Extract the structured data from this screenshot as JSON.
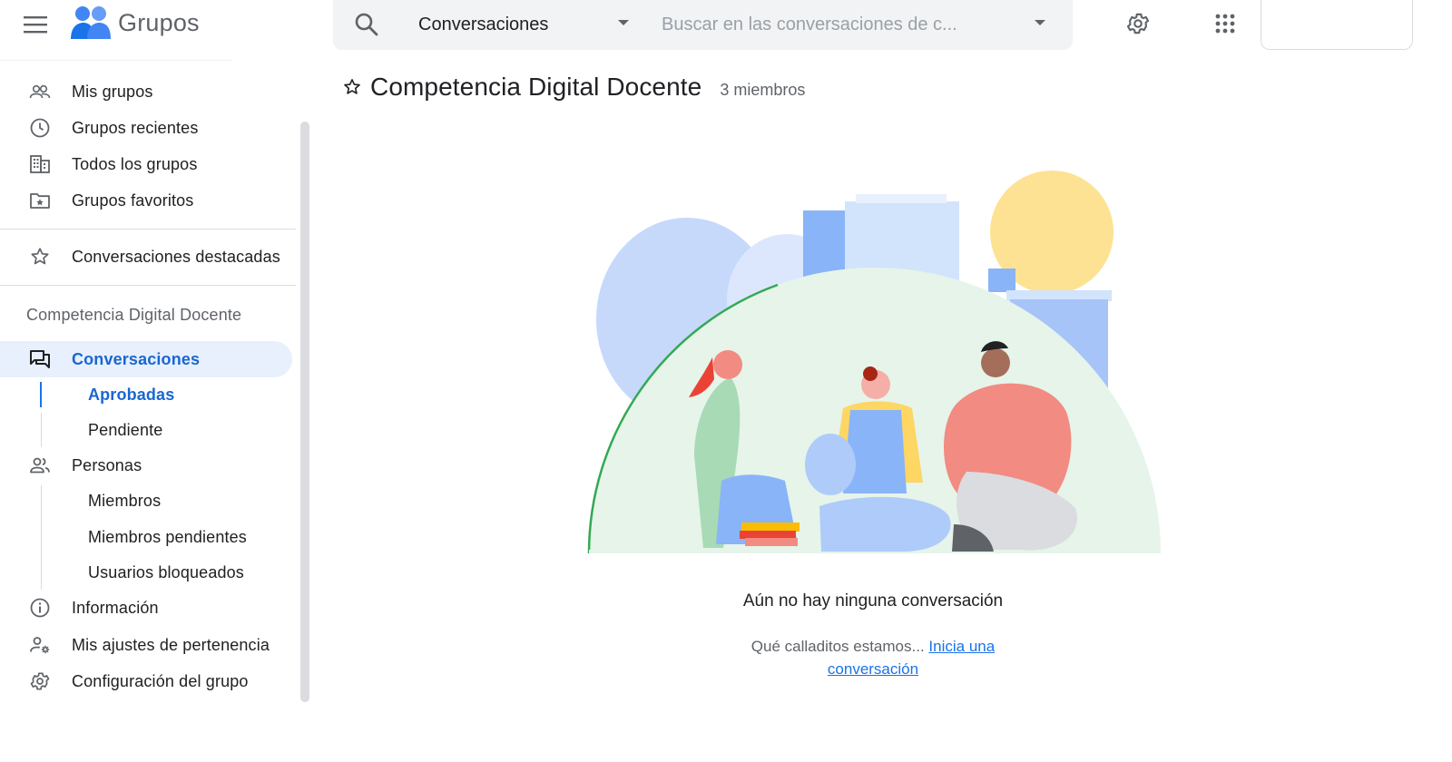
{
  "header": {
    "app_name": "Grupos",
    "search_scope": "Conversaciones",
    "search_placeholder": "Buscar en las conversaciones de c..."
  },
  "sidebar": {
    "global_items": [
      {
        "label": "Mis grupos",
        "icon": "people-icon"
      },
      {
        "label": "Grupos recientes",
        "icon": "clock-icon"
      },
      {
        "label": "Todos los grupos",
        "icon": "building-icon"
      },
      {
        "label": "Grupos favoritos",
        "icon": "folder-star-icon"
      }
    ],
    "starred_conversations": "Conversaciones destacadas",
    "group_heading": "Competencia Digital Docente",
    "conversations": {
      "label": "Conversaciones",
      "sub": [
        "Aprobadas",
        "Pendiente"
      ]
    },
    "people": {
      "label": "Personas",
      "sub": [
        "Miembros",
        "Miembros pendientes",
        "Usuarios bloqueados"
      ]
    },
    "info": "Información",
    "membership": "Mis ajustes de pertenencia",
    "group_settings": "Configuración del grupo"
  },
  "main": {
    "title": "Competencia Digital Docente",
    "member_count": "3 miembros",
    "empty_title": "Aún no hay ninguna conversación",
    "empty_text": "Qué calladitos estamos...",
    "empty_link": "Inicia una conversación"
  },
  "colors": {
    "accent": "#1a73e8",
    "active_bg": "#e8f0fe",
    "active_text": "#1967d2"
  }
}
